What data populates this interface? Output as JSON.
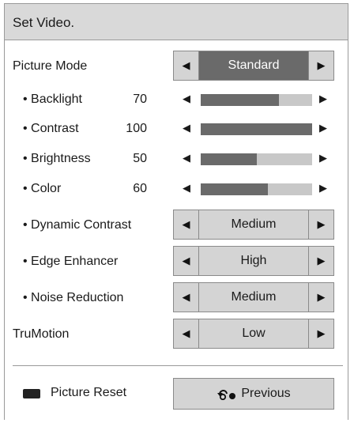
{
  "title": "Set Video.",
  "arrows": {
    "left": "◀",
    "right": "▶"
  },
  "picture_mode": {
    "label": "Picture Mode",
    "value": "Standard"
  },
  "sliders": [
    {
      "label": "• Backlight",
      "value": "70",
      "level": 0.7
    },
    {
      "label": "• Contrast",
      "value": "100",
      "level": 1.0
    },
    {
      "label": "• Brightness",
      "value": "50",
      "level": 0.5
    },
    {
      "label": "• Color",
      "value": "60",
      "level": 0.6
    }
  ],
  "selectors": [
    {
      "label": "• Dynamic Contrast",
      "value": "Medium"
    },
    {
      "label": "• Edge Enhancer",
      "value": "High"
    },
    {
      "label": "• Noise Reduction",
      "value": "Medium"
    }
  ],
  "trumotion": {
    "label": "TruMotion",
    "value": "Low"
  },
  "footer": {
    "reset_label": "Picture Reset",
    "previous_label": "Previous"
  },
  "colors": {
    "title_bg": "#d9d9d9",
    "active_bg": "#6a6a6a",
    "control_bg": "#d4d4d4",
    "track": "#c8c8c8"
  }
}
